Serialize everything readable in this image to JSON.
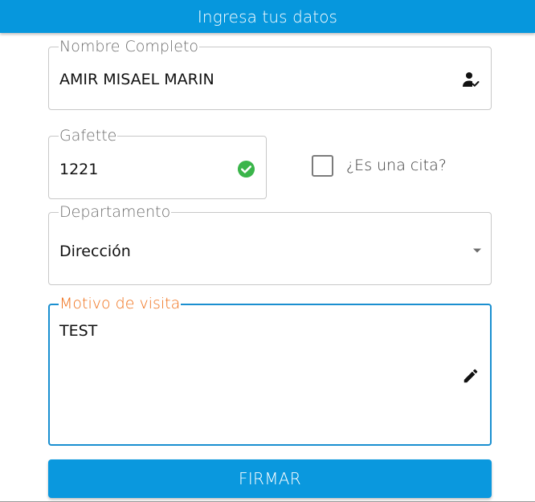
{
  "header": {
    "title": "Ingresa tus datos",
    "background_color": "#0697dd"
  },
  "form": {
    "nombre": {
      "label": "Nombre Completo",
      "value": "AMIR MISAEL MARIN",
      "icon": "person-check-icon"
    },
    "gafette": {
      "label": "Gafette",
      "value": "1221",
      "icon": "check-circle-icon",
      "icon_color": "#3ab54a"
    },
    "cita": {
      "label": "¿Es una cita?",
      "checked": false
    },
    "departamento": {
      "label": "Departamento",
      "selected": "Dirección",
      "icon": "dropdown-arrow-icon"
    },
    "motivo": {
      "label": "Motivo de visita",
      "value": "TEST",
      "icon": "pencil-icon",
      "focused": true,
      "label_color": "#f07019",
      "border_color": "#1a8fd0"
    }
  },
  "actions": {
    "submit_label": "FIRMAR",
    "submit_color": "#0a98de"
  }
}
